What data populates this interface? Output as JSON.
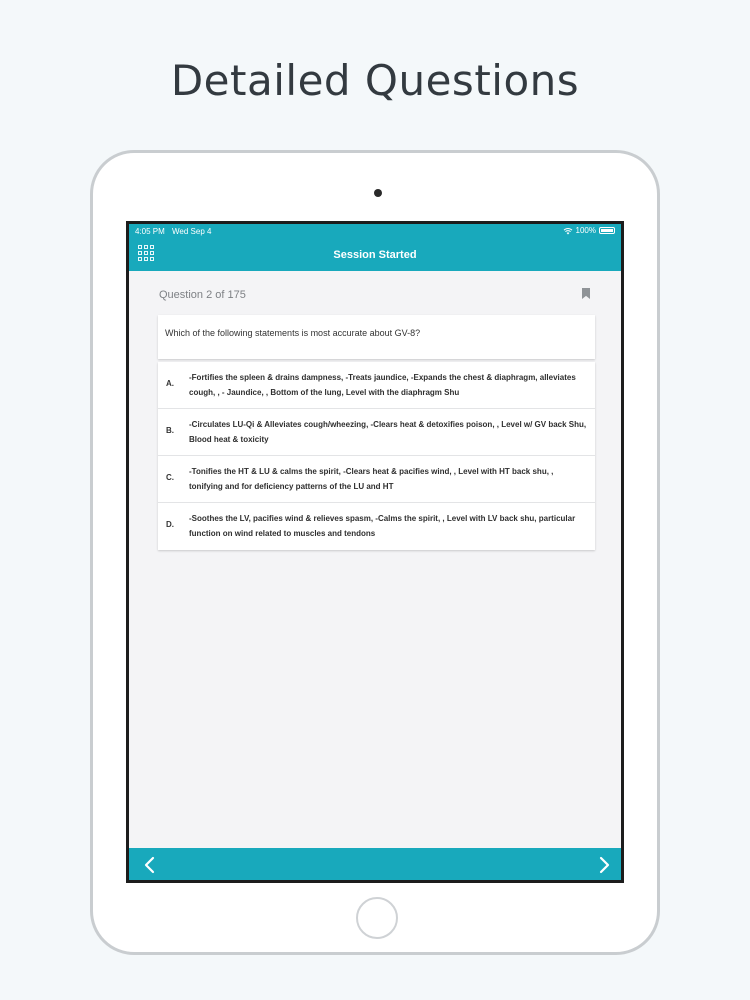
{
  "headline": "Detailed Questions",
  "status": {
    "time": "4:05 PM",
    "date": "Wed Sep 4",
    "battery": "100%"
  },
  "header": {
    "title": "Session Started",
    "menu_icon": "grid-icon"
  },
  "question": {
    "counter": "Question 2 of 175",
    "text": "Which of the following statements is most accurate about GV-8?",
    "bookmark_icon": "bookmark-icon"
  },
  "answers": [
    {
      "letter": "A.",
      "text": "-Fortifies the spleen & drains dampness, -Treats jaundice, -Expands the chest & diaphragm, alleviates cough, , - Jaundice, , Bottom of the lung, Level with the diaphragm Shu"
    },
    {
      "letter": "B.",
      "text": "-Circulates LU-Qi & Alleviates cough/wheezing, -Clears heat & detoxifies poison, , Level w/ GV back Shu, Blood heat & toxicity"
    },
    {
      "letter": "C.",
      "text": "-Tonifies the HT & LU & calms the spirit, -Clears heat & pacifies wind, , Level with HT back shu, , tonifying and for deficiency patterns of the LU and HT"
    },
    {
      "letter": "D.",
      "text": "-Soothes the LV, pacifies wind & relieves spasm, -Calms the spirit, , Level with LV back shu, particular function on wind related to muscles and tendons"
    }
  ],
  "footer": {
    "prev_icon": "chevron-left-icon",
    "next_icon": "chevron-right-icon"
  },
  "colors": {
    "accent": "#18a9bc",
    "background": "#f4f8fa"
  }
}
